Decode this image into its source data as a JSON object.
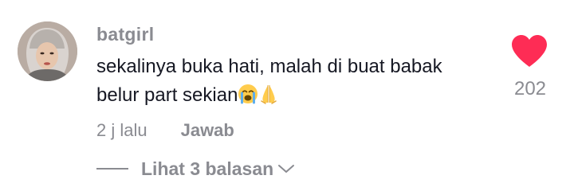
{
  "comment": {
    "username": "batgirl",
    "text_line1": "sekalinya buka hati, malah di buat babak",
    "text_line2": "belur part sekian",
    "emojis": [
      "loudly-crying-face-icon",
      "folded-hands-icon"
    ],
    "time": "2 j lalu",
    "reply_label": "Jawab",
    "view_replies_label": "Lihat 3 balasan",
    "like_count": "202",
    "liked": true
  },
  "colors": {
    "heart": "#fe2c55",
    "secondary_text": "#8a8b91",
    "primary_text": "#161823"
  }
}
